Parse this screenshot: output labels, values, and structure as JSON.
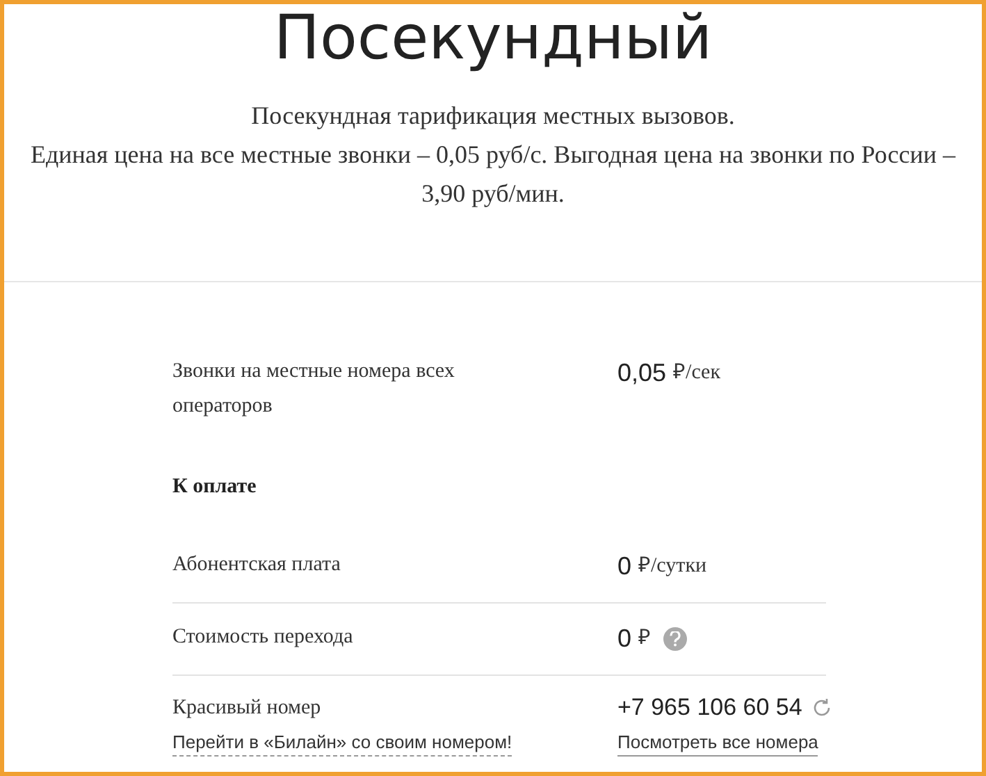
{
  "tariff": {
    "title": "Посекундный",
    "description": [
      "Посекундная тарификация местных вызовов.",
      "Единая цена на все местные звонки – 0,05 руб/с. Выгодная цена на звонки по России – 3,90 руб/мин."
    ]
  },
  "items": [
    {
      "kind": "price",
      "label": "Звонки на местные номера всех операторов",
      "amount": "0,05",
      "unit": "₽/сек",
      "help": false,
      "divider_below": false
    },
    {
      "kind": "heading",
      "label": "К оплате"
    },
    {
      "kind": "price",
      "label": "Абонентская плата",
      "amount": "0",
      "unit": "₽/сутки",
      "help": false,
      "divider_below": true
    },
    {
      "kind": "price",
      "label": "Стоимость перехода",
      "amount": "0",
      "unit": "₽",
      "help": true,
      "divider_below": true
    },
    {
      "kind": "number",
      "label": "Красивый номер",
      "link": "Перейти в «Билайн» со своим номером!",
      "number": "+7 965 106 60 54",
      "number_link": "Посмотреть все номера"
    }
  ]
}
